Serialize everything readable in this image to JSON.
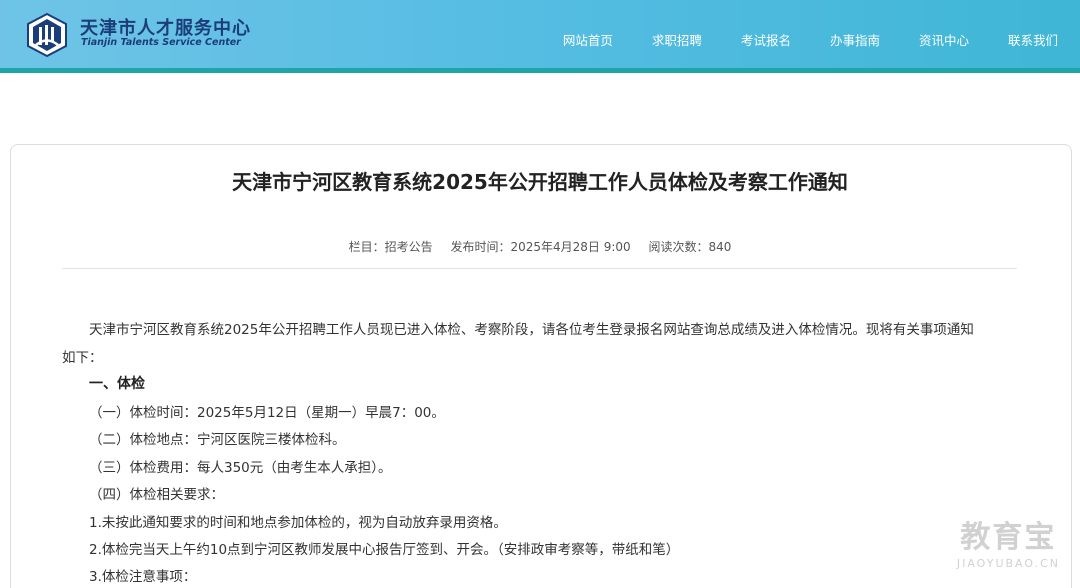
{
  "header": {
    "site_name": "天津市人才服务中心",
    "site_name_en": "Tianjin Talents Service Center",
    "logo_icon": "tianjin-talents-logo-icon",
    "nav": [
      {
        "label": "网站首页"
      },
      {
        "label": "求职招聘"
      },
      {
        "label": "考试报名"
      },
      {
        "label": "办事指南"
      },
      {
        "label": "资讯中心"
      },
      {
        "label": "联系我们"
      }
    ],
    "colors": {
      "header_start": "#6fc4e6",
      "header_end": "#3fb6d6",
      "accent_bar": "#1ea5a8",
      "logo_text": "#1b3d7a"
    }
  },
  "article": {
    "title": "天津市宁河区教育系统2025年公开招聘工作人员体检及考察工作通知",
    "meta": {
      "column": "栏目：招考公告",
      "published": "发布时间：2025年4月28日 9:00",
      "views": "阅读次数：840"
    },
    "intro_line1": "天津市宁河区教育系统2025年公开招聘工作人员现已进入体检、考察阶段，请各位考生登录报名网站查询总成绩及进入体检情况。现将有关事项通知",
    "intro_line2": "如下：",
    "section1_heading": "一、体检",
    "items": [
      "（一）体检时间：2025年5月12日（星期一）早晨7：00。",
      "（二）体检地点：宁河区医院三楼体检科。",
      "（三）体检费用：每人350元（由考生本人承担）。",
      "（四）体检相关要求："
    ],
    "requirements": [
      "1.未按此通知要求的时间和地点参加体检的，视为自动放弃录用资格。",
      "2.体检完当天上午约10点到宁河区教师发展中心报告厅签到、开会。（安排政审考察等，带纸和笔）",
      "3.体检注意事项："
    ]
  },
  "watermark": {
    "cn": "教育宝",
    "en": "JIAOYUBAO.CN"
  }
}
